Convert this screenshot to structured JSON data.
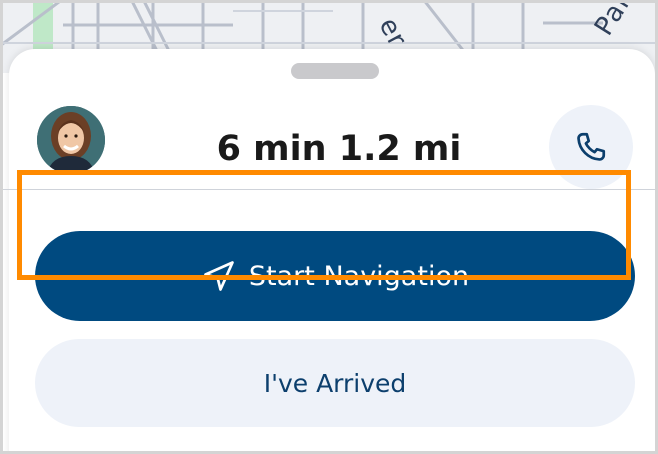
{
  "map": {
    "street_label_a": "er A",
    "street_label_b": "Park"
  },
  "trip": {
    "eta": "6 min",
    "distance": "1.2 mi"
  },
  "actions": {
    "start_navigation_label": "Start Navigation",
    "arrived_label": "I've Arrived"
  },
  "icons": {
    "call": "phone-icon",
    "navigation": "navigation-arrow-icon",
    "avatar": "passenger-avatar"
  },
  "colors": {
    "primary": "#004a80",
    "secondary_bg": "#eef2f9",
    "focus_outline": "#ff8a00",
    "text_dark": "#1a1a1a",
    "arrived_text": "#0c3f6d"
  }
}
